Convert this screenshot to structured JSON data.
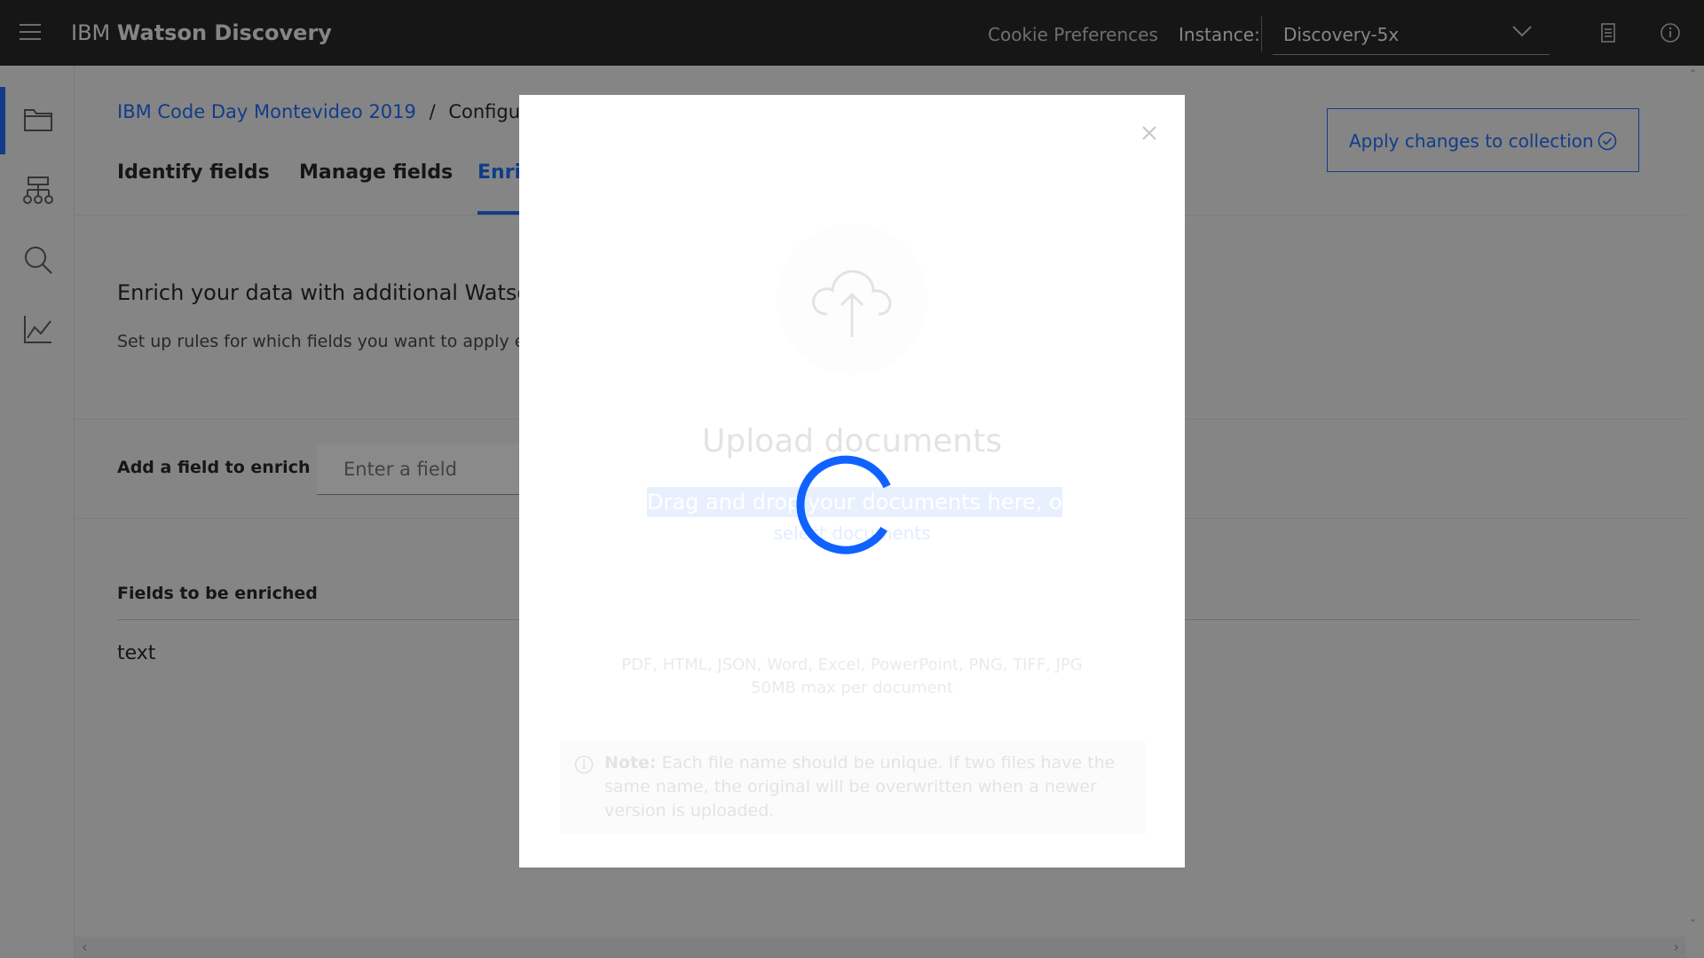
{
  "header": {
    "brand_prefix": "IBM",
    "brand_name": "Watson Discovery",
    "cookie_label": "Cookie Preferences",
    "instance_label": "Instance:",
    "instance_value": "Discovery-5x",
    "icons": [
      "menu-icon",
      "chevron-down-icon",
      "document-icon",
      "info-icon"
    ]
  },
  "rail": {
    "items": [
      {
        "icon": "folder-icon",
        "active": true
      },
      {
        "icon": "hierarchy-icon",
        "active": false
      },
      {
        "icon": "search-icon",
        "active": false
      },
      {
        "icon": "chart-line-icon",
        "active": false
      }
    ]
  },
  "breadcrumb": {
    "link": "IBM Code Day Montevideo 2019",
    "separator": "/",
    "current": "Configure d"
  },
  "apply_button": {
    "label": "Apply changes to collection",
    "icon": "checkmark-outline-icon"
  },
  "tabs": [
    {
      "label": "Identify fields",
      "active": false
    },
    {
      "label": "Manage fields",
      "active": false
    },
    {
      "label": "Enri",
      "active": true
    }
  ],
  "intro": {
    "title": "Enrich your data with additional Watso",
    "subtitle": "Set up rules for which fields you want to apply e"
  },
  "field_add": {
    "label": "Add a field to enrich",
    "placeholder": "Enter a field"
  },
  "fields_list": {
    "heading": "Fields to be enriched",
    "rows": [
      "text"
    ]
  },
  "modal": {
    "title": "Upload documents",
    "drag_text": "Drag and drop your documents here, or",
    "select_link": "select documents",
    "types": "PDF, HTML, JSON, Word, Excel, PowerPoint, PNG, TIFF, JPG",
    "size_limit": "50MB max per document",
    "note_bold": "Note:",
    "note_text": " Each file name should be unique. If two files have the same name, the original will be overwritten when a newer version is uploaded.",
    "loading": true
  },
  "colors": {
    "accent": "#0f62fe",
    "header_bg": "#161616",
    "page_bg": "#f4f4f4",
    "overlay": "rgba(22,22,22,0.5)"
  }
}
